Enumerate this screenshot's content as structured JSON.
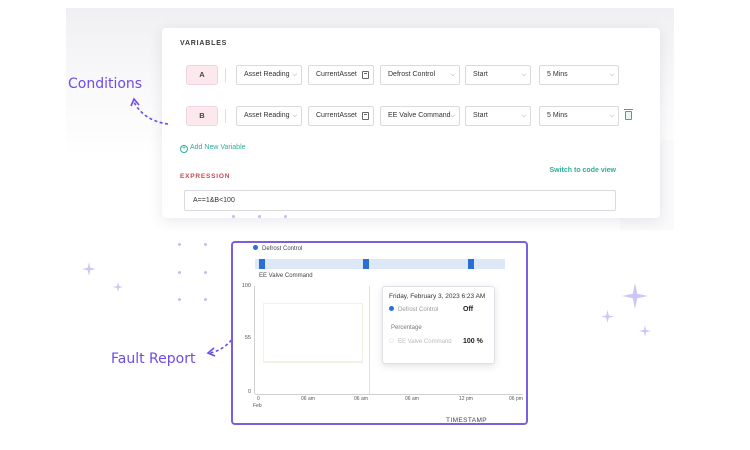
{
  "builder": {
    "variables_title": "VARIABLES",
    "rows": [
      {
        "var": "A",
        "source": "Asset Reading",
        "asset": "CurrentAsset",
        "tag": "Defrost Control",
        "point": "Start",
        "window": "5 Mins"
      },
      {
        "var": "B",
        "source": "Asset Reading",
        "asset": "CurrentAsset",
        "tag": "EE Valve Command",
        "point": "Start",
        "window": "5 Mins"
      }
    ],
    "add_variable": "Add New Variable",
    "switch_view": "Switch to code view",
    "expression_label": "EXPRESSION",
    "expression_value": "A==1&B<100"
  },
  "callouts": {
    "conditions": "Conditions",
    "fault_report": "Fault Report"
  },
  "chart": {
    "legend_1": "Defrost Control",
    "legend_2": "EE Valve Command",
    "y_ticks": [
      "100",
      "55",
      "0"
    ],
    "x_ticks": [
      "0",
      "06 am",
      "06 am",
      "06 am",
      "12 pm",
      "06 pm"
    ],
    "x_sub": "Feb",
    "x_label": "TIMESTAMP",
    "tooltip": {
      "date": "Friday, February 3, 2023 6:23 AM",
      "series_1_name": "Defrost Control",
      "series_1_value": "Off",
      "group_label": "Percentage",
      "series_2_name": "EE Valve Command",
      "series_2_value": "100 %"
    }
  },
  "colors": {
    "accent": "#6c4de6",
    "teal": "#2fae9a",
    "series_blue": "#2a6fd6",
    "expression_red": "#c8474f"
  },
  "chart_data": {
    "type": "line",
    "title": "",
    "series": [
      {
        "name": "Defrost Control",
        "values": []
      },
      {
        "name": "EE Valve Command",
        "values": []
      }
    ],
    "xlabel": "TIMESTAMP",
    "ylabel": "",
    "ylim": [
      0,
      100
    ],
    "y_ticks": [
      0,
      55,
      100
    ],
    "grid": false,
    "legend": "top-left"
  }
}
